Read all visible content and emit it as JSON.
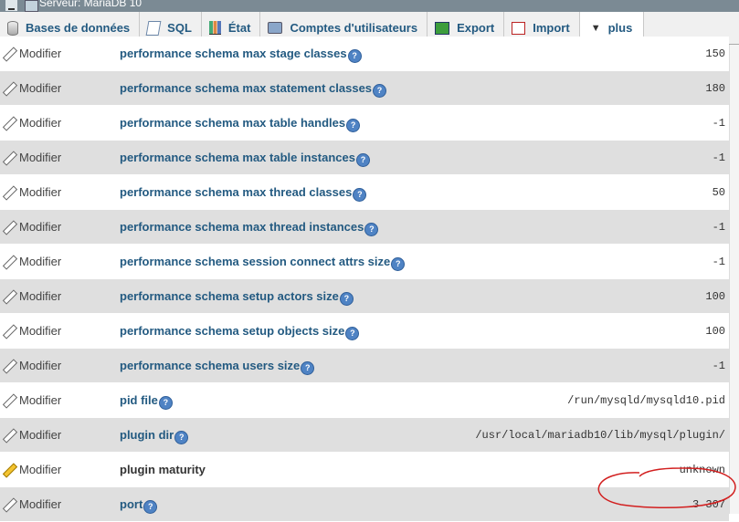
{
  "window": {
    "title": "Serveur: MariaDB 10"
  },
  "tabs": [
    {
      "label": "Bases de données",
      "icon": "database-icon"
    },
    {
      "label": "SQL",
      "icon": "sql-icon"
    },
    {
      "label": "État",
      "icon": "status-chart-icon"
    },
    {
      "label": "Comptes d'utilisateurs",
      "icon": "users-icon"
    },
    {
      "label": "Export",
      "icon": "export-icon"
    },
    {
      "label": "Import",
      "icon": "import-icon"
    },
    {
      "label": "plus",
      "icon": "dropdown-arrow-icon"
    }
  ],
  "edit_label": "Modifier",
  "rows": [
    {
      "name": "performance schema max stage classes",
      "value": "150",
      "help": true
    },
    {
      "name": "performance schema max statement classes",
      "value": "180",
      "help": true
    },
    {
      "name": "performance schema max table handles",
      "value": "-1",
      "help": true
    },
    {
      "name": "performance schema max table instances",
      "value": "-1",
      "help": true
    },
    {
      "name": "performance schema max thread classes",
      "value": "50",
      "help": true
    },
    {
      "name": "performance schema max thread instances",
      "value": "-1",
      "help": true
    },
    {
      "name": "performance schema session connect attrs size",
      "value": "-1",
      "help": true
    },
    {
      "name": "performance schema setup actors size",
      "value": "100",
      "help": true
    },
    {
      "name": "performance schema setup objects size",
      "value": "100",
      "help": true
    },
    {
      "name": "performance schema users size",
      "value": "-1",
      "help": true
    },
    {
      "name": "pid file",
      "value": "/run/mysqld/mysqld10.pid",
      "help": true
    },
    {
      "name": "plugin dir",
      "value": "/usr/local/mariadb10/lib/mysql/plugin/",
      "help": true
    },
    {
      "name": "plugin maturity",
      "value": "unknown",
      "help": false
    },
    {
      "name": "port",
      "value": "3 307",
      "help": true
    }
  ],
  "colors": {
    "link": "#235a81",
    "row_even": "#dfdfdf",
    "row_odd": "#ffffff",
    "annotation": "#d21f1f"
  }
}
